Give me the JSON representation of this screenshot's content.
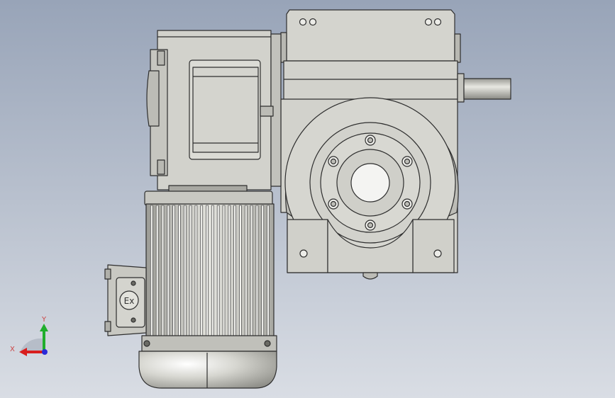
{
  "triad": {
    "x_label": "X",
    "y_label": "Y",
    "x_color": "#d81e1e",
    "y_color": "#1fae2c",
    "z_color": "#2a2ad8"
  },
  "part_colors": {
    "body": "#d2d2cc",
    "body_shade": "#a6a6a0",
    "outline": "#2e2e2e",
    "motor_cap": "#e6e6e0",
    "background_top": "#98a4b8",
    "background_bottom": "#d9dde4"
  },
  "terminal_box": {
    "badge_text": "Ex"
  }
}
